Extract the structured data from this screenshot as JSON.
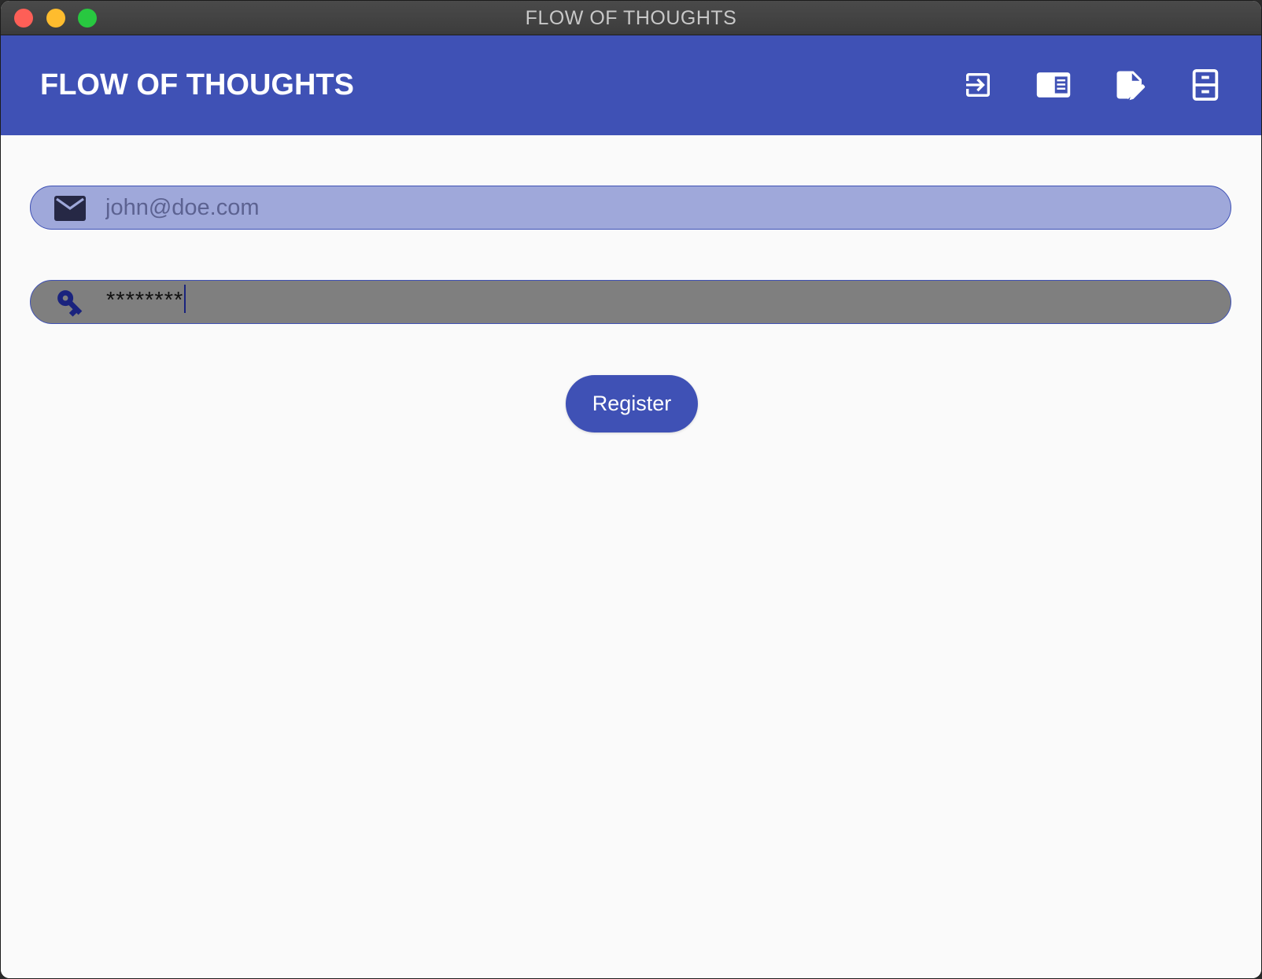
{
  "window": {
    "title": "FLOW OF THOUGHTS",
    "controls": [
      "close",
      "minimize",
      "maximize"
    ]
  },
  "appbar": {
    "title": "FLOW OF THOUGHTS",
    "color": "#3f51b5",
    "actions": [
      {
        "icon": "login-icon"
      },
      {
        "icon": "chrome-reader-icon"
      },
      {
        "icon": "note-edit-icon"
      },
      {
        "icon": "archive-icon"
      }
    ]
  },
  "form": {
    "email": {
      "icon": "mail-icon",
      "placeholder": "john@doe.com",
      "value": "",
      "background": "#9fa8da"
    },
    "password": {
      "icon": "key-icon",
      "masked_value": "********",
      "background": "#7f7f7f"
    },
    "submit_label": "Register"
  }
}
